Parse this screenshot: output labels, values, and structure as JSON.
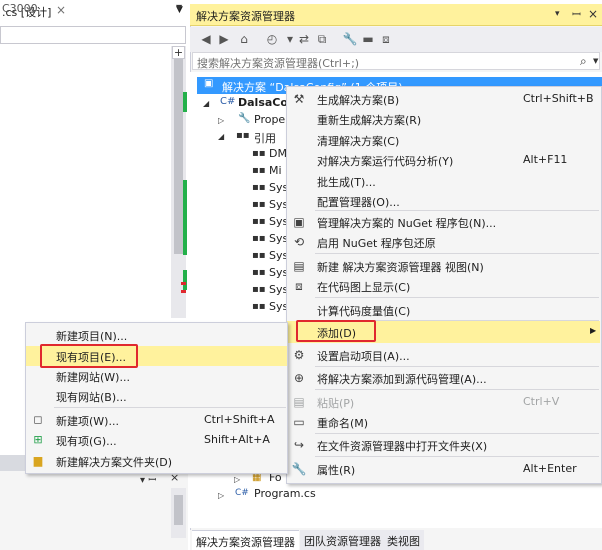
{
  "left_editor": {
    "tab_title": ".cs [设计]",
    "tab_close": "×",
    "combo_value": "C3000"
  },
  "solution_explorer": {
    "title": "解决方案资源管理器",
    "title_buttons": {
      "dropdown": "▾",
      "pin": "ꟷ",
      "close": "×"
    },
    "search_placeholder": "搜索解决方案资源管理器(Ctrl+;)",
    "tree": {
      "solution": "解决方案 “DalsaConfig” (1 个项目)",
      "project": "DalsaCo",
      "properties": "Prope",
      "references": "引用",
      "reference_items": [
        "DM",
        "Mi",
        "Sys",
        "Sys",
        "Sys",
        "Sys",
        "Sys",
        "Sys",
        "Sys",
        "Sys"
      ],
      "form_item": "Fo",
      "program": "Program.cs"
    },
    "bottom_tabs": [
      "解决方案资源管理器",
      "团队资源管理器",
      "类视图"
    ]
  },
  "context_menu": {
    "items": [
      {
        "label": "生成解决方案(B)",
        "shortcut": "Ctrl+Shift+B",
        "icon": "build-icon"
      },
      {
        "label": "重新生成解决方案(R)",
        "shortcut": "",
        "icon": ""
      },
      {
        "label": "清理解决方案(C)",
        "shortcut": "",
        "icon": ""
      },
      {
        "label": "对解决方案运行代码分析(Y)",
        "shortcut": "Alt+F11",
        "icon": ""
      },
      {
        "label": "批生成(T)...",
        "shortcut": "",
        "icon": ""
      },
      {
        "label": "配置管理器(O)...",
        "shortcut": "",
        "icon": ""
      },
      {
        "label": "管理解决方案的 NuGet 程序包(N)...",
        "shortcut": "",
        "icon": "nuget-icon"
      },
      {
        "label": "启用 NuGet 程序包还原",
        "shortcut": "",
        "icon": "nuget-restore-icon"
      },
      {
        "label": "新建 解决方案资源管理器 视图(N)",
        "shortcut": "",
        "icon": "new-view-icon"
      },
      {
        "label": "在代码图上显示(C)",
        "shortcut": "",
        "icon": "code-map-icon"
      },
      {
        "label": "计算代码度量值(C)",
        "shortcut": "",
        "icon": ""
      },
      {
        "label": "添加(D)",
        "shortcut": "",
        "icon": ""
      },
      {
        "label": "设置启动项目(A)...",
        "shortcut": "",
        "icon": "gear-icon"
      },
      {
        "label": "将解决方案添加到源代码管理(A)...",
        "shortcut": "",
        "icon": "source-control-icon"
      },
      {
        "label": "粘贴(P)",
        "shortcut": "Ctrl+V",
        "icon": "paste-icon"
      },
      {
        "label": "重命名(M)",
        "shortcut": "",
        "icon": "rename-icon"
      },
      {
        "label": "在文件资源管理器中打开文件夹(X)",
        "shortcut": "",
        "icon": "open-folder-icon"
      },
      {
        "label": "属性(R)",
        "shortcut": "Alt+Enter",
        "icon": "wrench-icon"
      }
    ],
    "submenu_arrow": "▶"
  },
  "add_submenu": {
    "items": [
      {
        "label": "新建项目(N)...",
        "shortcut": ""
      },
      {
        "label": "现有项目(E)...",
        "shortcut": ""
      },
      {
        "label": "新建网站(W)...",
        "shortcut": ""
      },
      {
        "label": "现有网站(B)...",
        "shortcut": ""
      },
      {
        "label": "新建项(W)...",
        "shortcut": "Ctrl+Shift+A"
      },
      {
        "label": "现有项(G)...",
        "shortcut": "Shift+Alt+A"
      },
      {
        "label": "新建解决方案文件夹(D)",
        "shortcut": ""
      }
    ]
  },
  "colors": {
    "highlight": "#fff29d",
    "selection": "#3399ff",
    "callout_red": "#e0282e",
    "change_green": "#23b04a"
  }
}
